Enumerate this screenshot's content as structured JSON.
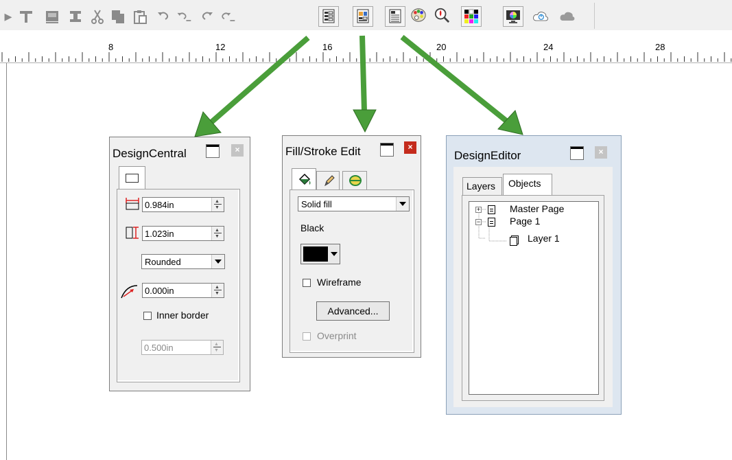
{
  "toolbar": {
    "icons": [
      "text-tool-icon",
      "image-icon",
      "align-icon",
      "cut-icon",
      "copy-icon",
      "paste-icon",
      "undo-icon",
      "undo-list-icon",
      "redo-icon",
      "redo-list-icon",
      "design-central-icon",
      "fill-stroke-editor-icon",
      "design-editor-icon",
      "palette-icon",
      "zoom-icon",
      "color-chart-icon",
      "monitor-color-icon",
      "cloud-sync-icon",
      "cloud-icon"
    ]
  },
  "ruler": {
    "labels": [
      "8",
      "12",
      "16",
      "20",
      "24",
      "28"
    ]
  },
  "design_central": {
    "title": "DesignCentral",
    "width_value": "0.984in",
    "height_value": "1.023in",
    "corner_style": "Rounded",
    "radius_value": "0.000in",
    "inner_border_label": "Inner border",
    "inner_border_checked": false,
    "border_offset_value": "0.500in"
  },
  "fill_stroke": {
    "title": "Fill/Stroke Edit",
    "fill_type": "Solid fill",
    "color_name": "Black",
    "color_hex": "#000000",
    "wireframe_label": "Wireframe",
    "wireframe_checked": false,
    "advanced_label": "Advanced...",
    "overprint_label": "Overprint",
    "overprint_checked": false
  },
  "design_editor": {
    "title": "DesignEditor",
    "tabs": [
      {
        "label": "Layers",
        "active": false
      },
      {
        "label": "Objects",
        "active": true
      }
    ],
    "tree": [
      {
        "label": "Master Page",
        "expander": "+"
      },
      {
        "label": "Page 1",
        "expander": "-"
      },
      {
        "label": "Layer 1"
      }
    ]
  },
  "colors": {
    "arrow": "#4a9e3a",
    "close_red": "#c42b1c",
    "chrome": "#f0f0f0"
  }
}
